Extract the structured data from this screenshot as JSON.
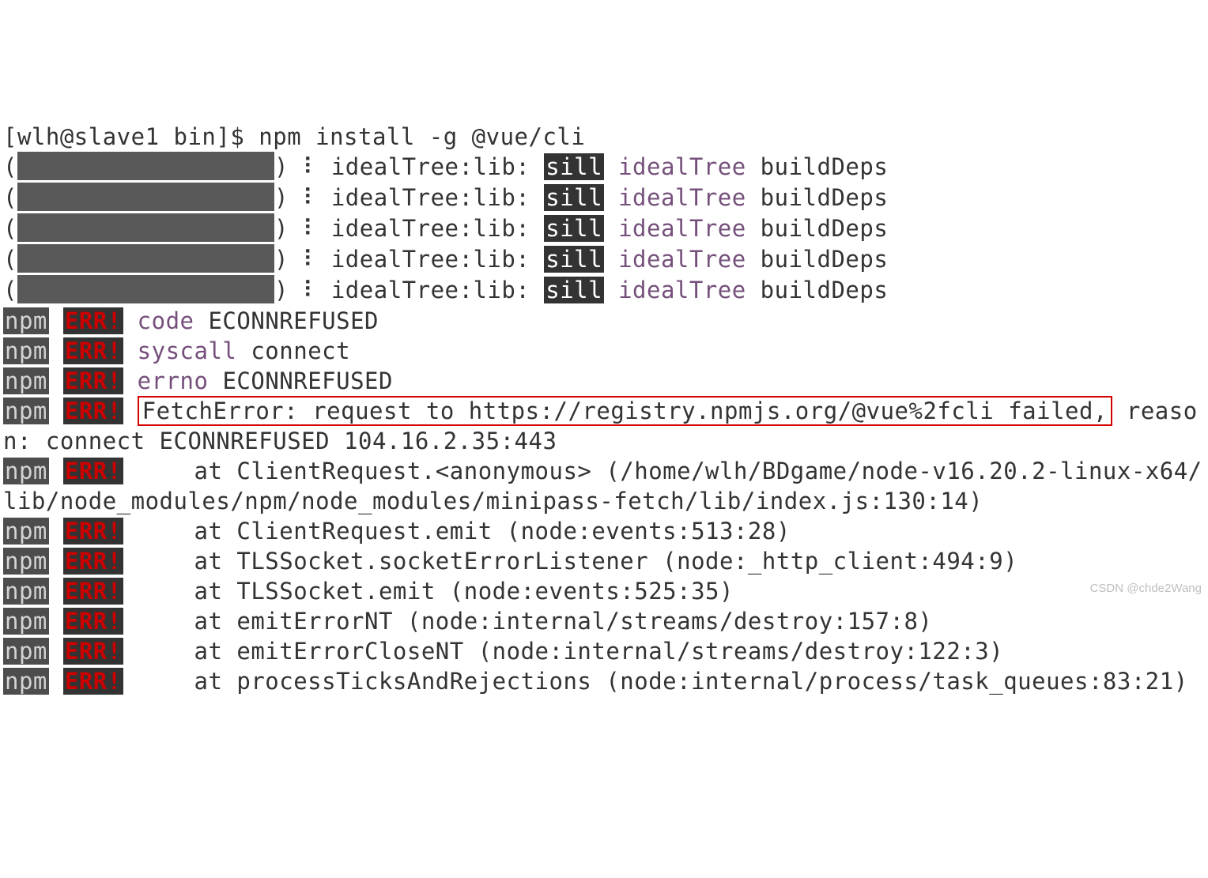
{
  "prompt": "[wlh@slave1 bin]$ ",
  "command": "npm install -g @vue/cli",
  "spinnerChar": "⠇",
  "progressPrefix": "idealTree:lib:",
  "sill": "sill",
  "idealTree": "idealTree",
  "buildDeps": "buildDeps",
  "progressCount": 5,
  "npm": "npm",
  "err": "ERR!",
  "errors": {
    "code_label": "code",
    "code_value": "ECONNREFUSED",
    "syscall_label": "syscall",
    "syscall_value": "connect",
    "errno_label": "errno",
    "errno_value": "ECONNREFUSED",
    "fetch_boxed": "FetchError: request to https://registry.npmjs.org/@vue%2fcli failed,",
    "fetch_tail": " reason: connect ECONNREFUSED 104.16.2.35:443",
    "stack": [
      "     at ClientRequest.<anonymous> (/home/wlh/BDgame/node-v16.20.2-linux-x64/lib/node_modules/npm/node_modules/minipass-fetch/lib/index.js:130:14)",
      "     at ClientRequest.emit (node:events:513:28)",
      "     at TLSSocket.socketErrorListener (node:_http_client:494:9)",
      "     at TLSSocket.emit (node:events:525:35)",
      "     at emitErrorNT (node:internal/streams/destroy:157:8)",
      "     at emitErrorCloseNT (node:internal/streams/destroy:122:3)",
      "     at processTicksAndRejections (node:internal/process/task_queues:83:21)"
    ]
  },
  "watermark": "CSDN @chde2Wang"
}
